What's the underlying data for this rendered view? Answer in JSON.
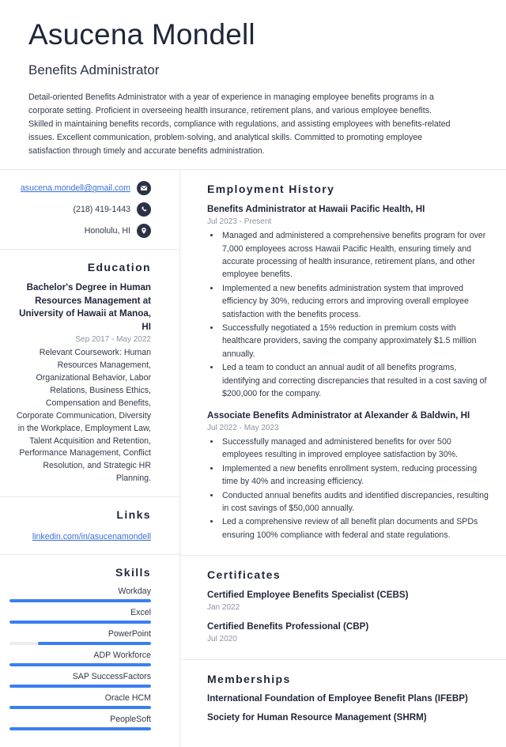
{
  "theme": {
    "accent_blue": "#3b7ef2",
    "link_blue": "#3b6fd4",
    "heading_navy": "#1f2639",
    "muted_gray": "#8d93a1",
    "rule_gray": "#e7e9ee"
  },
  "header": {
    "name": "Asucena Mondell",
    "job_title": "Benefits Administrator",
    "summary": "Detail-oriented Benefits Administrator with a year of experience in managing employee benefits programs in a corporate setting. Proficient in overseeing health insurance, retirement plans, and various employee benefits. Skilled in maintaining benefits records, compliance with regulations, and assisting employees with benefits-related issues. Excellent communication, problem-solving, and analytical skills. Committed to promoting employee satisfaction through timely and accurate benefits administration."
  },
  "contact": {
    "email": "asucena.mondell@gmail.com",
    "email_icon": "envelope-icon",
    "phone": "(218) 419-1443",
    "phone_icon": "phone-icon",
    "location": "Honolulu, HI",
    "location_icon": "map-pin-icon"
  },
  "education": {
    "heading": "Education",
    "degree": "Bachelor's Degree in Human Resources Management at University of Hawaii at Manoa, HI",
    "dates": "Sep 2017 - May 2022",
    "description": "Relevant Coursework: Human Resources Management, Organizational Behavior, Labor Relations, Business Ethics, Compensation and Benefits, Corporate Communication, Diversity in the Workplace, Employment Law, Talent Acquisition and Retention, Performance Management, Conflict Resolution, and Strategic HR Planning."
  },
  "links": {
    "heading": "Links",
    "items": [
      {
        "label": "linkedin.com/in/asucenamondell"
      }
    ]
  },
  "skills": {
    "heading": "Skills",
    "items": [
      {
        "name": "Workday",
        "level": 100
      },
      {
        "name": "Excel",
        "level": 100
      },
      {
        "name": "PowerPoint",
        "level": 80
      },
      {
        "name": "ADP Workforce",
        "level": 100
      },
      {
        "name": "SAP SuccessFactors",
        "level": 100
      },
      {
        "name": "Oracle HCM",
        "level": 100
      },
      {
        "name": "PeopleSoft",
        "level": 100
      }
    ]
  },
  "employment": {
    "heading": "Employment History",
    "entries": [
      {
        "title": "Benefits Administrator at Hawaii Pacific Health, HI",
        "dates": "Jul 2023 - Present",
        "bullets": [
          "Managed and administered a comprehensive benefits program for over 7,000 employees across Hawaii Pacific Health, ensuring timely and accurate processing of health insurance, retirement plans, and other employee benefits.",
          "Implemented a new benefits administration system that improved efficiency by 30%, reducing errors and improving overall employee satisfaction with the benefits process.",
          "Successfully negotiated a 15% reduction in premium costs with healthcare providers, saving the company approximately $1.5 million annually.",
          "Led a team to conduct an annual audit of all benefits programs, identifying and correcting discrepancies that resulted in a cost saving of $200,000 for the company."
        ]
      },
      {
        "title": "Associate Benefits Administrator at Alexander & Baldwin, HI",
        "dates": "Jul 2022 - May 2023",
        "bullets": [
          "Successfully managed and administered benefits for over 500 employees resulting in improved employee satisfaction by 30%.",
          "Implemented a new benefits enrollment system, reducing processing time by 40% and increasing efficiency.",
          "Conducted annual benefits audits and identified discrepancies, resulting in cost savings of $50,000 annually.",
          "Led a comprehensive review of all benefit plan documents and SPDs ensuring 100% compliance with federal and state regulations."
        ]
      }
    ]
  },
  "certificates": {
    "heading": "Certificates",
    "entries": [
      {
        "title": "Certified Employee Benefits Specialist (CEBS)",
        "date": "Jan 2022"
      },
      {
        "title": "Certified Benefits Professional (CBP)",
        "date": "Jul 2020"
      }
    ]
  },
  "memberships": {
    "heading": "Memberships",
    "entries": [
      {
        "title": "International Foundation of Employee Benefit Plans (IFEBP)"
      },
      {
        "title": "Society for Human Resource Management (SHRM)"
      }
    ]
  }
}
